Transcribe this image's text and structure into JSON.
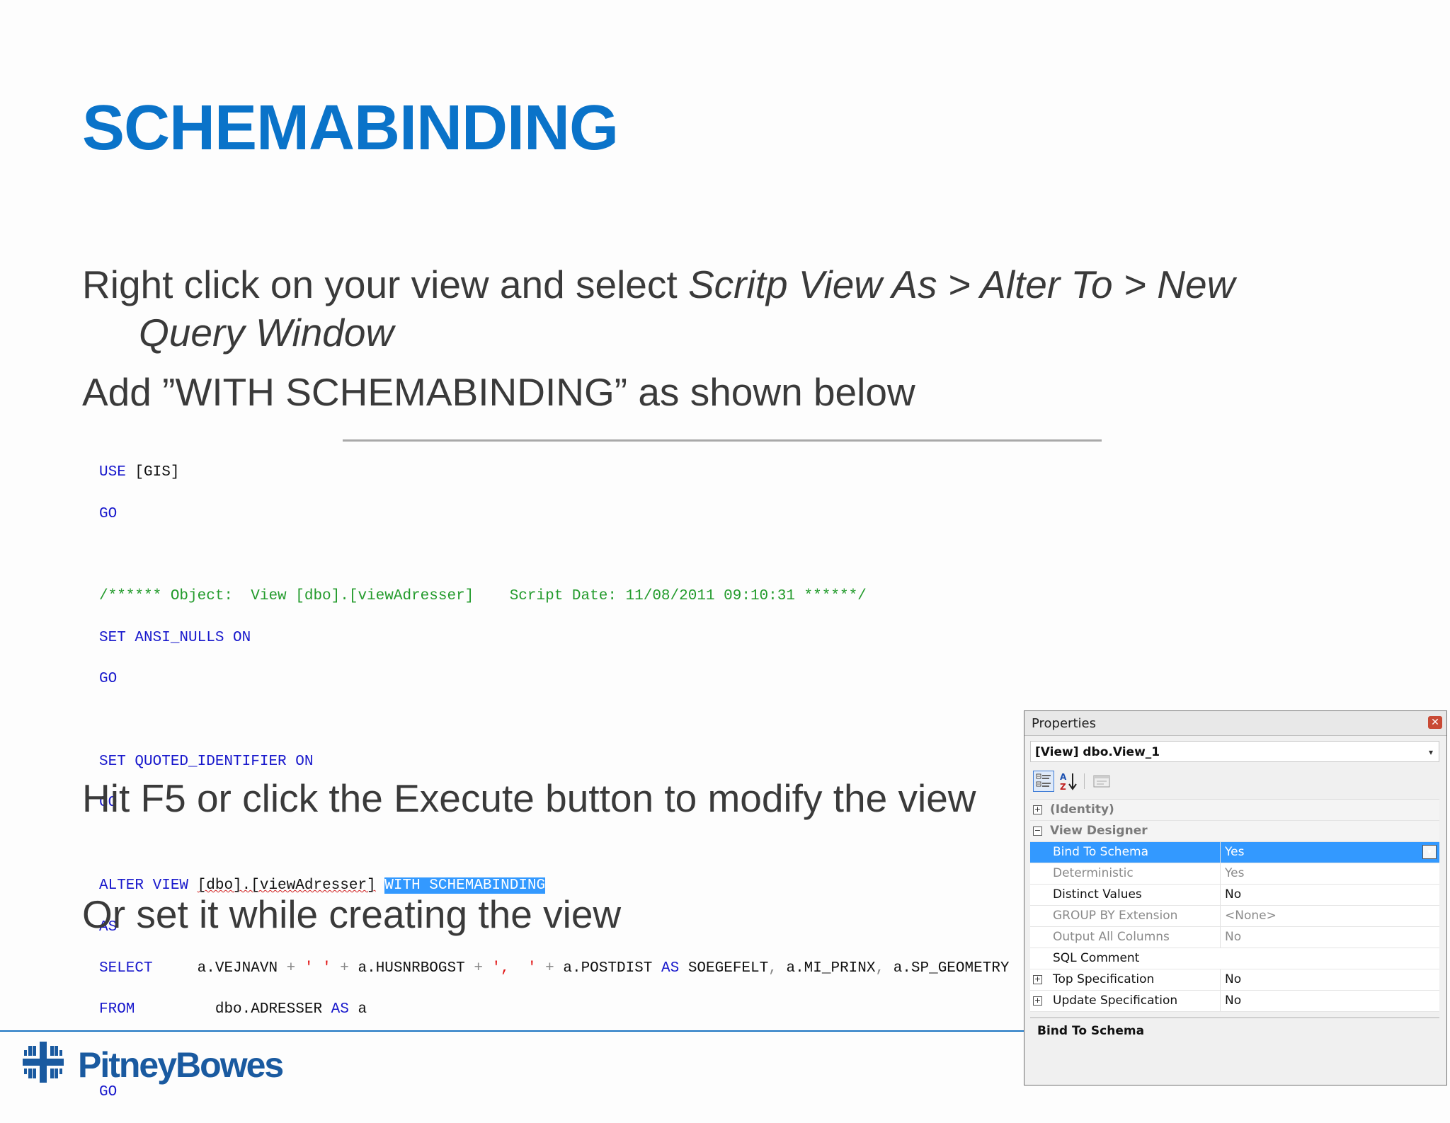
{
  "slide": {
    "title": "SCHEMABINDING",
    "bullet1_a": "Right click on your view and select ",
    "bullet1_b": "Scritp View As > Alter To > New",
    "bullet1_c": "Query Window",
    "bullet2": "Add ”WITH SCHEMABINDING” as shown below",
    "bullet3": "Hit F5 or click the Execute button to modify the view",
    "bullet4": "Or set it while creating the view"
  },
  "code": {
    "l1_kw": "USE",
    "l1_rest": " [GIS]",
    "go": "GO",
    "l3_comment": "/****** Object:  View [dbo].[viewAdresser]    Script Date: 11/08/2011 09:10:31 ******/",
    "l4_kw": "SET ANSI_NULLS ON",
    "l6_kw": "SET QUOTED_IDENTIFIER ON",
    "l8_kw": "ALTER VIEW",
    "l8_obj": "[dbo].[viewAdresser]",
    "l8_sel": "WITH SCHEMABINDING",
    "l9_kw": "AS",
    "l10_kw": "SELECT",
    "l10_a": "     a.VEJNAVN ",
    "l10_plus": "+",
    "l10_s1": " ' ' ",
    "l10_b": " a.HUSNRBOGST ",
    "l10_s2": " ',  ' ",
    "l10_c": " a.POSTDIST ",
    "l10_as": "AS",
    "l10_d": " SOEGEFELT",
    "l10_comma": ",",
    "l10_e": " a.MI_PRINX",
    "l10_f": " a.SP_GEOMETRY",
    "l11_kw": "FROM",
    "l11_a": "         dbo.ADRESSER ",
    "l11_as": "AS",
    "l11_b": " a"
  },
  "properties": {
    "window_title": "Properties",
    "object": "[View] dbo.View_1",
    "rows": [
      {
        "name": "(Identity)",
        "value": "",
        "type": "category",
        "expander": "+"
      },
      {
        "name": "View Designer",
        "value": "",
        "type": "category",
        "expander": "−"
      },
      {
        "name": "Bind To Schema",
        "value": "Yes",
        "type": "selected"
      },
      {
        "name": "Deterministic",
        "value": "Yes",
        "type": "disabled"
      },
      {
        "name": "Distinct Values",
        "value": "No",
        "type": "normal"
      },
      {
        "name": "GROUP BY Extension",
        "value": "<None>",
        "type": "disabled"
      },
      {
        "name": "Output All Columns",
        "value": "No",
        "type": "disabled"
      },
      {
        "name": "SQL Comment",
        "value": "",
        "type": "normal"
      },
      {
        "name": "Top Specification",
        "value": "No",
        "type": "normal",
        "expander": "+"
      },
      {
        "name": "Update Specification",
        "value": "No",
        "type": "normal",
        "expander": "+"
      }
    ],
    "description_title": "Bind To Schema"
  },
  "footer": {
    "logo_text": "PitneyBowes"
  },
  "colors": {
    "title_blue": "#0a73c9",
    "keyword_blue": "#1818cc",
    "comment_green": "#239b2c",
    "string_red": "#e01010",
    "selection_blue": "#3399ff",
    "brand_blue": "#1a5aa0"
  }
}
